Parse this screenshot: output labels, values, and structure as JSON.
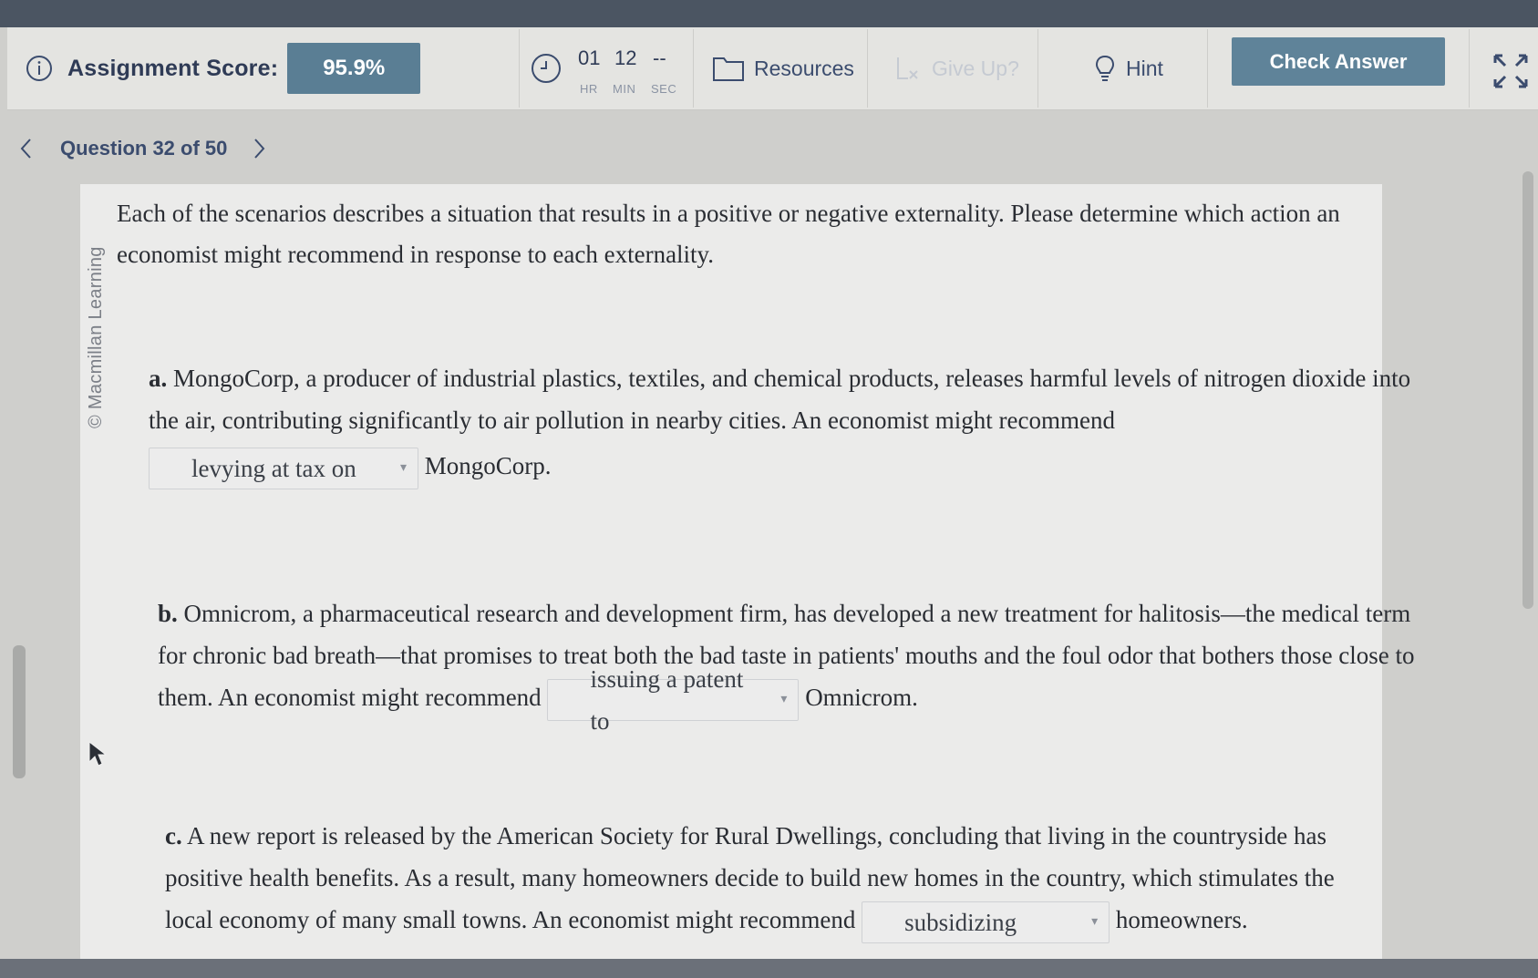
{
  "toolbar": {
    "score_label": "Assignment Score:",
    "score_value": "95.9%",
    "timer": {
      "hr_value": "01",
      "min_value": "12",
      "sec_value": "--",
      "hr_label": "HR",
      "min_label": "MIN",
      "sec_label": "SEC"
    },
    "resources_label": "Resources",
    "give_up_label": "Give Up?",
    "hint_label": "Hint",
    "check_answer_label": "Check Answer"
  },
  "question_nav": {
    "title": "Question 32 of 50"
  },
  "watermark": "© Macmillan Learning",
  "intro": "Each of the scenarios describes a situation that results in a positive or negative externality. Please determine which action an economist might recommend in response to each externality.",
  "questions": [
    {
      "letter": "a.",
      "text": "MongoCorp, a producer of industrial plastics, textiles, and chemical products, releases harmful levels of nitrogen dioxide into the air, contributing significantly to air pollution in nearby cities. An economist might recommend",
      "selected": "levying at tax on",
      "after": "MongoCorp."
    },
    {
      "letter": "b.",
      "text": "Omnicrom, a pharmaceutical research and development firm, has developed a new treatment for halitosis—the medical term for chronic bad breath—that promises to treat both the bad taste in patients' mouths and the foul odor that bothers those close to them. An economist might recommend",
      "selected": "issuing a patent to",
      "after": "Omnicrom."
    },
    {
      "letter": "c.",
      "text": "A new report is released by the American Society for Rural Dwellings, concluding that living in the countryside has positive health benefits. As a result, many homeowners decide to build new homes in the country, which stimulates the local economy of many small towns. An economist might recommend",
      "selected": "subsidizing",
      "after": "homeowners."
    }
  ],
  "colors": {
    "accent": "#5a7e94",
    "check_button": "#5f8399",
    "nav_text": "#3b4c6e"
  },
  "icons": [
    "info-icon",
    "clock-icon",
    "folder-icon",
    "give-up-icon",
    "lightbulb-icon",
    "expand-icon",
    "chevron-left-icon",
    "chevron-right-icon",
    "dropdown-caret-icon",
    "mouse-pointer-icon"
  ]
}
